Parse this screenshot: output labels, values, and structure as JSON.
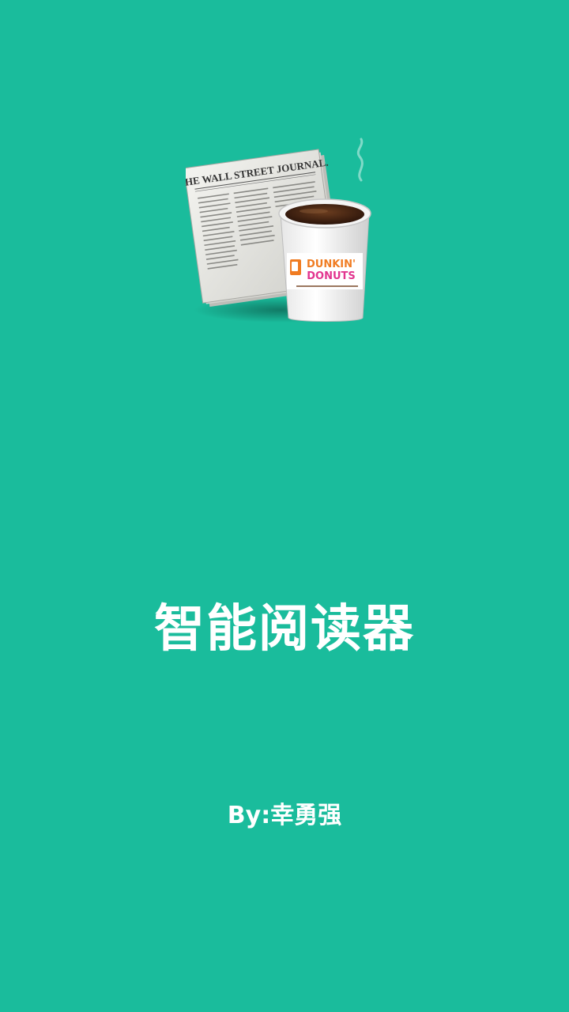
{
  "splash": {
    "background_color": "#1abc9c",
    "logo": {
      "icon": "newspaper-coffee-icon",
      "newspaper_masthead": "THE WALL STREET JOURNAL.",
      "cup_brand_line1": "DUNKIN'",
      "cup_brand_line2": "DONUTS"
    },
    "title": "智能阅读器",
    "author": "By:幸勇强"
  }
}
